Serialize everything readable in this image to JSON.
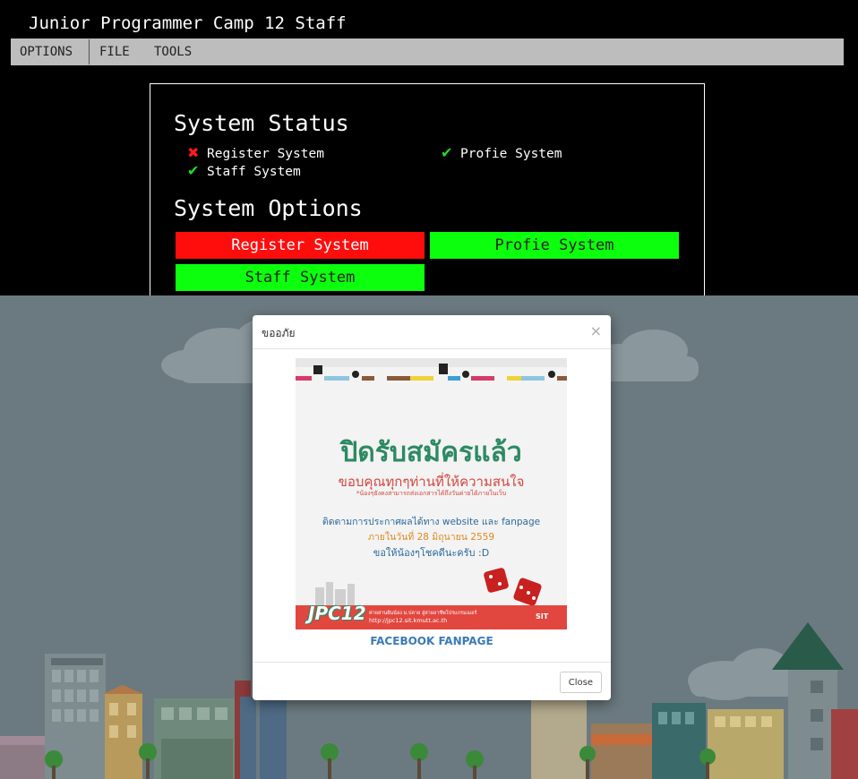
{
  "app": {
    "title": "Junior Programmer Camp 12 Staff"
  },
  "menu": {
    "options": "OPTIONS",
    "file": "FILE",
    "tools": "TOOLS"
  },
  "status": {
    "title": "System Status",
    "items": [
      {
        "label": "Register System",
        "state": "down"
      },
      {
        "label": "Profie System",
        "state": "up"
      },
      {
        "label": "Staff System",
        "state": "up"
      }
    ]
  },
  "options": {
    "title": "System Options",
    "buttons": [
      {
        "label": "Register System",
        "color": "#ff0d0d"
      },
      {
        "label": "Profie System",
        "color": "#0cff0c"
      },
      {
        "label": "Staff System",
        "color": "#0cff0c"
      }
    ]
  },
  "icons": {
    "down": "cross-icon",
    "up": "check-icon"
  },
  "modal": {
    "title": "ขออภัย",
    "close_symbol": "×",
    "link": "FACEBOOK FANPAGE",
    "close_button": "Close",
    "poster": {
      "headline": "ปิดรับสมัครแล้ว",
      "thanks": "ขอบคุณทุกๆท่านที่ให้ความสนใจ",
      "note": "*น้องๆยังคงสามารถส่งเอกสารได้ถึงวันค่ายได้ภายในเว็บ",
      "follow": "ติดตามการประกาศผลได้ทาง website และ fanpage",
      "date": "ภายในวันที่ 28 มิถุนายน 2559",
      "luck": "ขอให้น้องๆโชคดีนะครับ :D",
      "logo": "JPC12",
      "caption": "ค่ายสานฝันน้อง ม.ปลาย สู่สายอาชีพโปรแกรมเมอร์",
      "url": "http://jpc12.sit.kmutt.ac.th",
      "org": "SIT"
    }
  },
  "colors": {
    "backdrop": "#6b7a80",
    "poster_bar": "#e2473f",
    "headline": "#2c8a62",
    "link": "#3a7ab8"
  }
}
